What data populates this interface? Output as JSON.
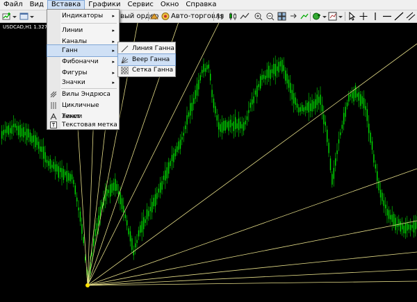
{
  "menubar": {
    "items": [
      "Файл",
      "Вид",
      "Вставка",
      "Графики",
      "Сервис",
      "Окно",
      "Справка"
    ],
    "active_index": 2
  },
  "toolbar": {
    "new_order_label": "вый ордер",
    "autotrading_label": "Авто-торговля"
  },
  "chart": {
    "symbol_label": "USDCAD,H1  1.327",
    "candle_color": "#00e000",
    "gann_line_color": "#e8e08a"
  },
  "insert_menu": {
    "items": [
      {
        "label": "Индикаторы",
        "submenu": true
      },
      {
        "label": "Линии",
        "submenu": true
      },
      {
        "label": "Каналы",
        "submenu": true
      },
      {
        "label": "Ганн",
        "submenu": true,
        "highlighted": true
      },
      {
        "label": "Фибоначчи",
        "submenu": true
      },
      {
        "label": "Фигуры",
        "submenu": true
      },
      {
        "label": "Значки",
        "submenu": true
      },
      {
        "label": "Вилы Эндрюса",
        "icon": "andrews-pitchfork-icon"
      },
      {
        "label": "Цикличные линии",
        "icon": "cycle-lines-icon"
      },
      {
        "label": "Текст",
        "icon": "text-icon"
      },
      {
        "label": "Текстовая метка",
        "icon": "text-label-icon"
      }
    ],
    "arrow": "▸"
  },
  "gann_submenu": {
    "items": [
      {
        "label": "Линия Ганна",
        "icon": "gann-line-icon"
      },
      {
        "label": "Веер Ганна",
        "icon": "gann-fan-icon",
        "highlighted": true
      },
      {
        "label": "Сетка Ганна",
        "icon": "gann-grid-icon"
      }
    ]
  }
}
